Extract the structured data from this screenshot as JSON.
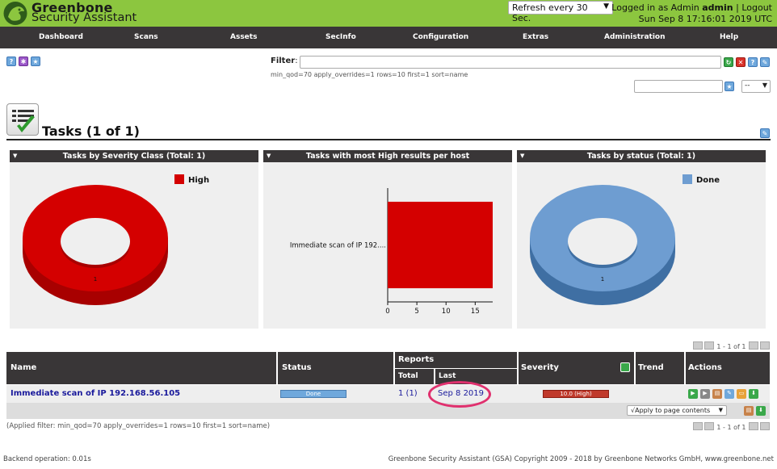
{
  "header": {
    "brand_line1": "Greenbone",
    "brand_line2": "Security Assistant",
    "refresh_selected": "Refresh every 30 Sec.",
    "logged_in_label": "Logged in as",
    "role": "Admin",
    "username": "admin",
    "separator": "|",
    "logout": "Logout",
    "datetime": "Sun Sep 8 17:16:01 2019 UTC"
  },
  "nav": [
    "Dashboard",
    "Scans",
    "Assets",
    "SecInfo",
    "Configuration",
    "Extras",
    "Administration",
    "Help"
  ],
  "filter": {
    "label": "Filter",
    "value": "",
    "filter_string": "min_qod=70 apply_overrides=1 rows=10 first=1 sort=name",
    "select_value": "--"
  },
  "page": {
    "title": "Tasks (1 of 1)"
  },
  "dashboard": {
    "panels": [
      {
        "title": "Tasks by Severity Class (Total: 1)",
        "chart_data": {
          "type": "pie",
          "categories": [
            "High"
          ],
          "values": [
            1
          ],
          "colors": [
            "#d40000"
          ],
          "legend": "top-right"
        }
      },
      {
        "title": "Tasks with most High results per host",
        "chart_data": {
          "type": "bar",
          "orientation": "horizontal",
          "categories": [
            "Immediate scan of IP 192...."
          ],
          "values": [
            18
          ],
          "xlim": [
            0,
            18
          ],
          "xticks": [
            "0",
            "5",
            "10",
            "15"
          ],
          "color": "#d40000"
        }
      },
      {
        "title": "Tasks by status (Total: 1)",
        "chart_data": {
          "type": "pie",
          "categories": [
            "Done"
          ],
          "values": [
            1
          ],
          "colors": [
            "#6e9dd1"
          ],
          "legend": "top-right"
        }
      }
    ]
  },
  "table": {
    "pager": "1 - 1 of 1",
    "headers": {
      "name": "Name",
      "status": "Status",
      "reports": "Reports",
      "total": "Total",
      "last": "Last",
      "severity": "Severity",
      "trend": "Trend",
      "actions": "Actions"
    },
    "rows": [
      {
        "name": "Immediate scan of IP 192.168.56.105",
        "status": "Done",
        "status_progress": 1.0,
        "reports_total": "1 (1)",
        "reports_last": "Sep 8 2019",
        "severity": "10.0 (High)",
        "severity_value": 10.0
      }
    ],
    "apply_select": "√Apply to page contents",
    "applied_filter": "(Applied filter: min_qod=70 apply_overrides=1 rows=10 first=1 sort=name)"
  },
  "footer": {
    "backend": "Backend operation: 0.01s",
    "copyright": "Greenbone Security Assistant (GSA) Copyright 2009 - 2018 by Greenbone Networks GmbH, www.greenbone.net"
  }
}
